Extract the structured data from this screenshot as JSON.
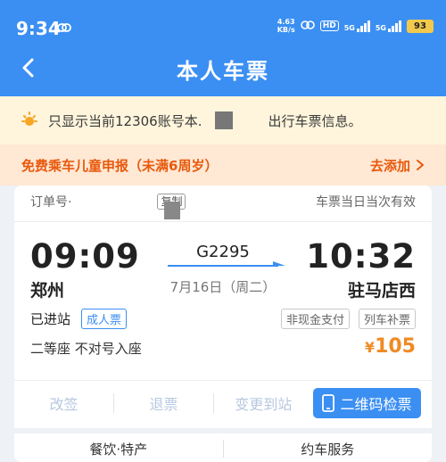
{
  "status_bar": {
    "time": "9:34",
    "net_speed_top": "4.63",
    "net_speed_bottom": "KB/s",
    "hd": "HD",
    "sig1": "5G",
    "sig2": "5G",
    "battery": "93"
  },
  "nav": {
    "title": "本人车票"
  },
  "notice": {
    "text_left": "只显示当前12306账号本.",
    "text_right": "出行车票信息。"
  },
  "child_banner": {
    "title": "免费乘车儿童申报（未满6周岁）",
    "action": "去添加"
  },
  "ticket": {
    "order_label": "订单号·",
    "copy_label": "复制",
    "validity": "车票当日当次有效",
    "departure_time": "09:09",
    "arrival_time": "10:32",
    "departure_station": "郑州",
    "arrival_station": "驻马店西",
    "train_no": "G2295",
    "date": "7月16日（周二）",
    "status": "已进站",
    "passenger_type": "成人票",
    "tags": [
      "非现金支付",
      "列车补票"
    ],
    "seat": "二等座 不对号入座",
    "currency": "¥",
    "price": "105",
    "actions": [
      "改签",
      "退票",
      "变更到站"
    ],
    "qr_button": "二维码检票",
    "bottom": [
      "餐饮·特产",
      "约车服务"
    ]
  },
  "colors": {
    "primary": "#3b8ff2",
    "accent": "#e8590c",
    "price": "#f08a24"
  }
}
